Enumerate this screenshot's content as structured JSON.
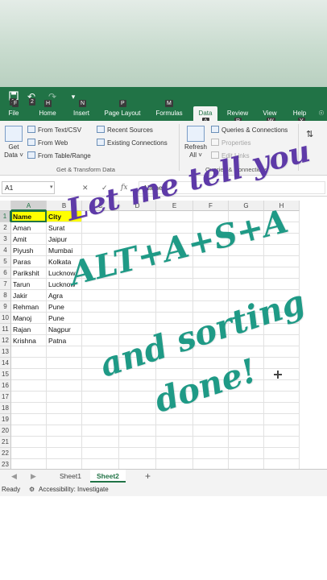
{
  "quick_access": {
    "keytips": [
      "1",
      "2"
    ]
  },
  "tabs": [
    {
      "label": "File",
      "keytip": "F"
    },
    {
      "label": "Home",
      "keytip": "H"
    },
    {
      "label": "Insert",
      "keytip": "N"
    },
    {
      "label": "Page Layout",
      "keytip": "P"
    },
    {
      "label": "Formulas",
      "keytip": "M"
    },
    {
      "label": "Data",
      "keytip": "A"
    },
    {
      "label": "Review",
      "keytip": "R"
    },
    {
      "label": "View",
      "keytip": "W"
    },
    {
      "label": "Help",
      "keytip": "Y"
    }
  ],
  "ribbon": {
    "get_data": "Get\nData ˅",
    "from_text_csv": "From Text/CSV",
    "from_web": "From Web",
    "from_table_range": "From Table/Range",
    "recent_sources": "Recent Sources",
    "existing_connections": "Existing Connections",
    "group_get_transform": "Get & Transform Data",
    "refresh_all": "Refresh\nAll ˅",
    "queries_connections": "Queries & Connections",
    "properties": "Properties",
    "edit_links": "Edit Links",
    "group_queries": "Queries & Connections"
  },
  "formula_bar": {
    "name_box": "A1",
    "cancel": "✕",
    "enter": "✓",
    "fx": "fx",
    "value": "Name"
  },
  "sheet": {
    "columns": [
      "A",
      "B",
      "C",
      "D",
      "E",
      "F",
      "G",
      "H"
    ],
    "rows": [
      "1",
      "2",
      "3",
      "4",
      "5",
      "6",
      "7",
      "8",
      "9",
      "10",
      "11",
      "12",
      "13",
      "14",
      "15",
      "16",
      "17",
      "18",
      "19",
      "20",
      "21",
      "22",
      "23"
    ],
    "header": [
      "Name",
      "City"
    ],
    "data": [
      [
        "Aman",
        "Surat"
      ],
      [
        "Amit",
        "Jaipur"
      ],
      [
        "Piyush",
        "Mumbai"
      ],
      [
        "Paras",
        "Kolkata"
      ],
      [
        "Parikshit",
        "Lucknow"
      ],
      [
        "Tarun",
        "Lucknow"
      ],
      [
        "Jakir",
        "Agra"
      ],
      [
        "Rehman",
        "Pune"
      ],
      [
        "Manoj",
        "Pune"
      ],
      [
        "Rajan",
        "Nagpur"
      ],
      [
        "Krishna",
        "Patna"
      ]
    ],
    "header_fill": "#ffff00"
  },
  "sheet_tabs": [
    "Sheet1",
    "Sheet2"
  ],
  "active_sheet": "Sheet2",
  "add_sheet": "+",
  "status": {
    "ready": "Ready",
    "accessibility": "Accessibility: Investigate"
  },
  "overlay": {
    "line1": "Let me tell you",
    "line2": "ALT+A+S+A",
    "line3": "and sorting",
    "line4": "done!"
  },
  "colors": {
    "excel_green": "#217346",
    "overlay_purple": "#5e3aa8",
    "overlay_teal": "#1f9a86"
  }
}
